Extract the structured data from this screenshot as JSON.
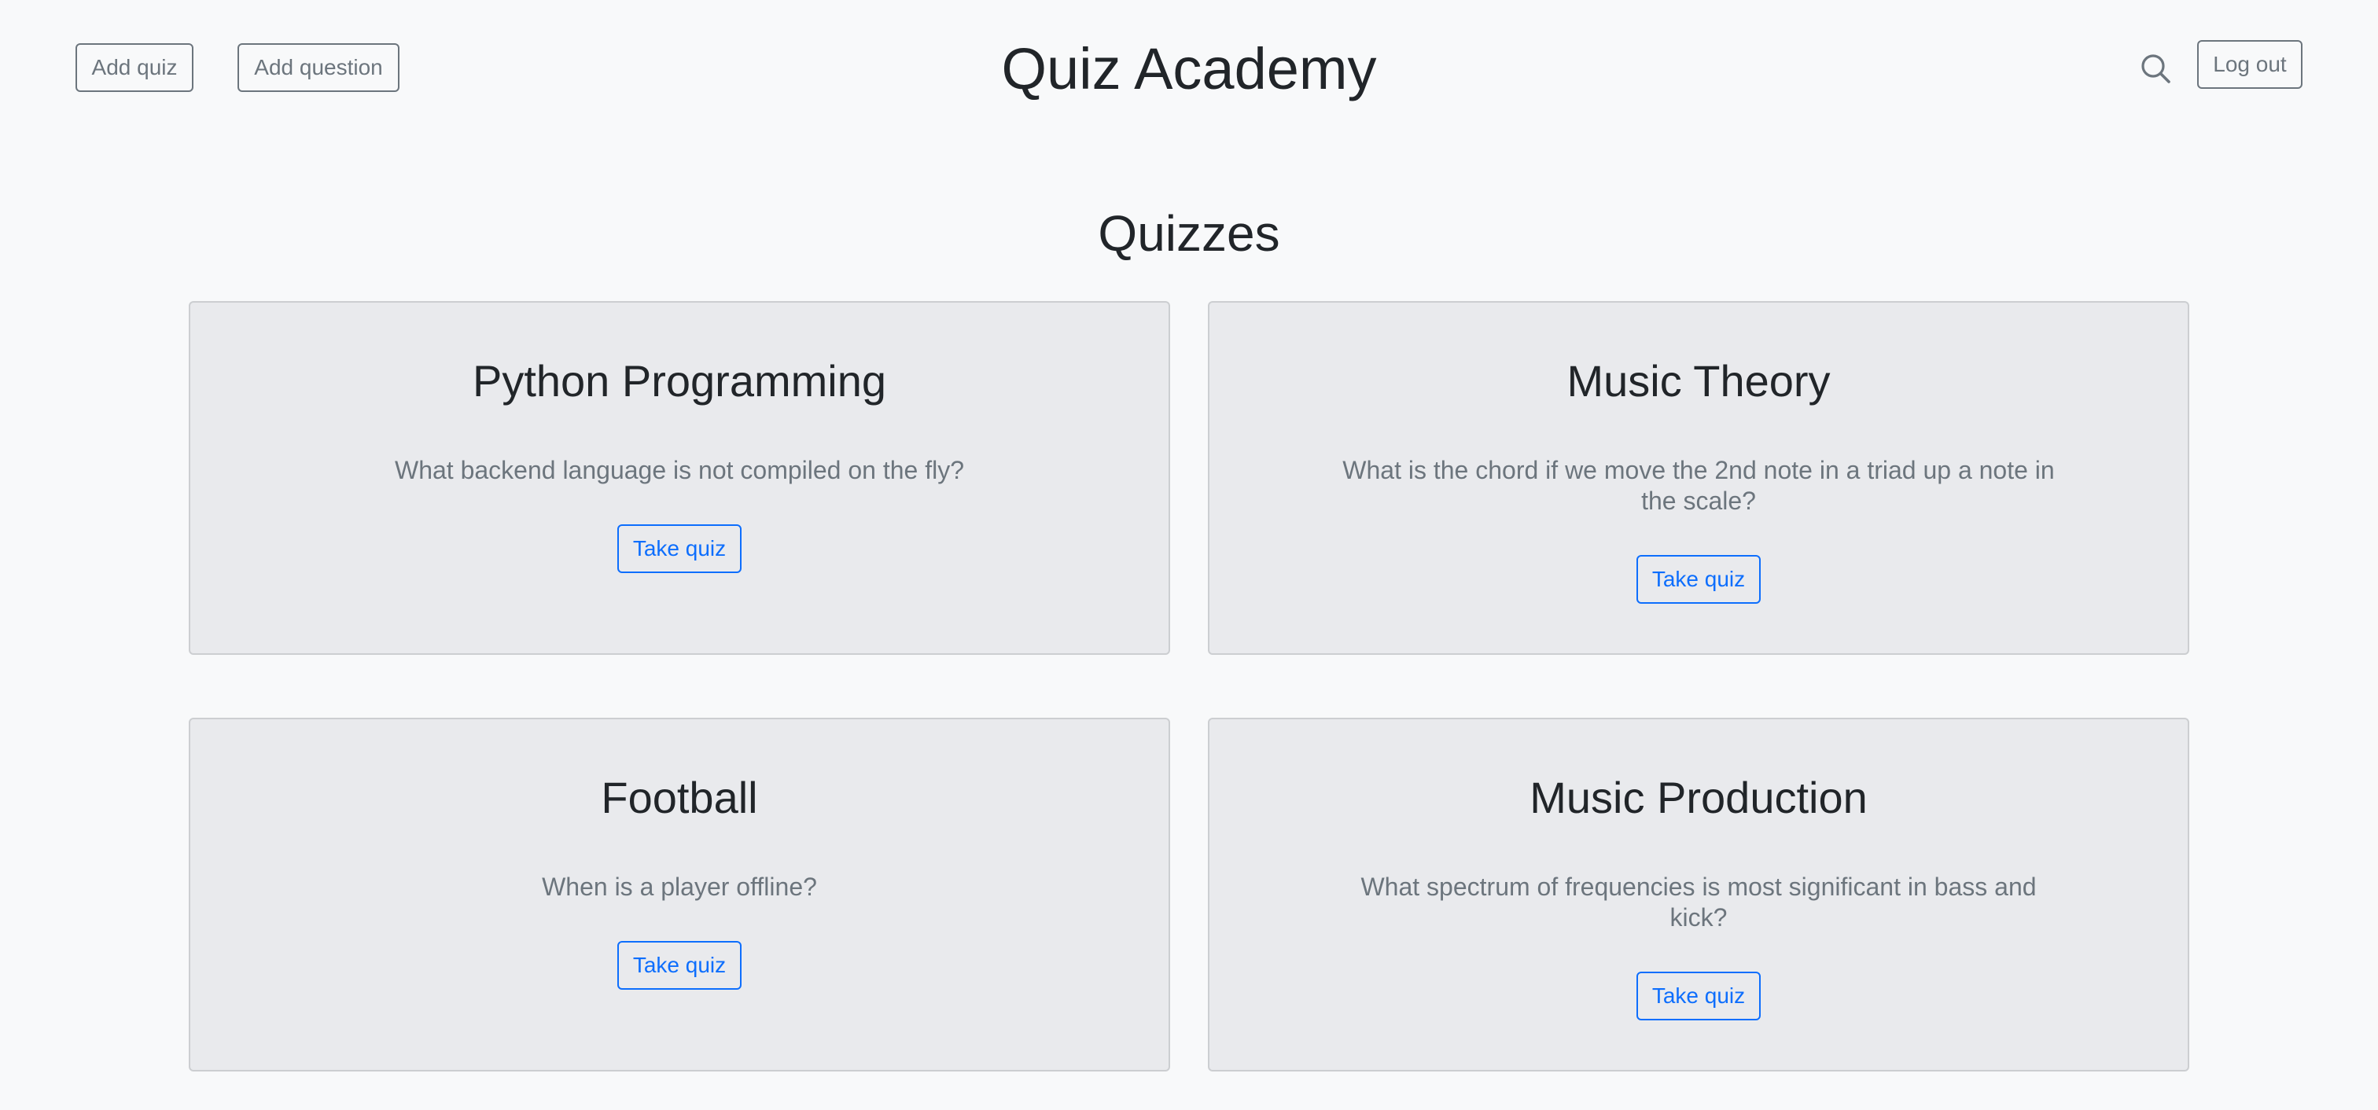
{
  "header": {
    "add_quiz_label": "Add quiz",
    "add_question_label": "Add question",
    "site_title": "Quiz Academy",
    "search_icon": "search-icon",
    "logout_label": "Log out"
  },
  "main": {
    "heading": "Quizzes",
    "take_quiz_label": "Take quiz",
    "quizzes": [
      {
        "title": "Python Programming",
        "question": "What backend language is not compiled on the fly?"
      },
      {
        "title": "Music Theory",
        "question": "What is the chord if we move the 2nd note in a triad up a note in the scale?"
      },
      {
        "title": "Football",
        "question": "When is a player offline?"
      },
      {
        "title": "Music Production",
        "question": "What spectrum of frequencies is most significant in bass and kick?"
      }
    ]
  },
  "colors": {
    "background": "#f8f9fa",
    "card_background": "#e9eaed",
    "primary": "#0d6efd",
    "secondary": "#6c757d",
    "text": "#212529"
  }
}
